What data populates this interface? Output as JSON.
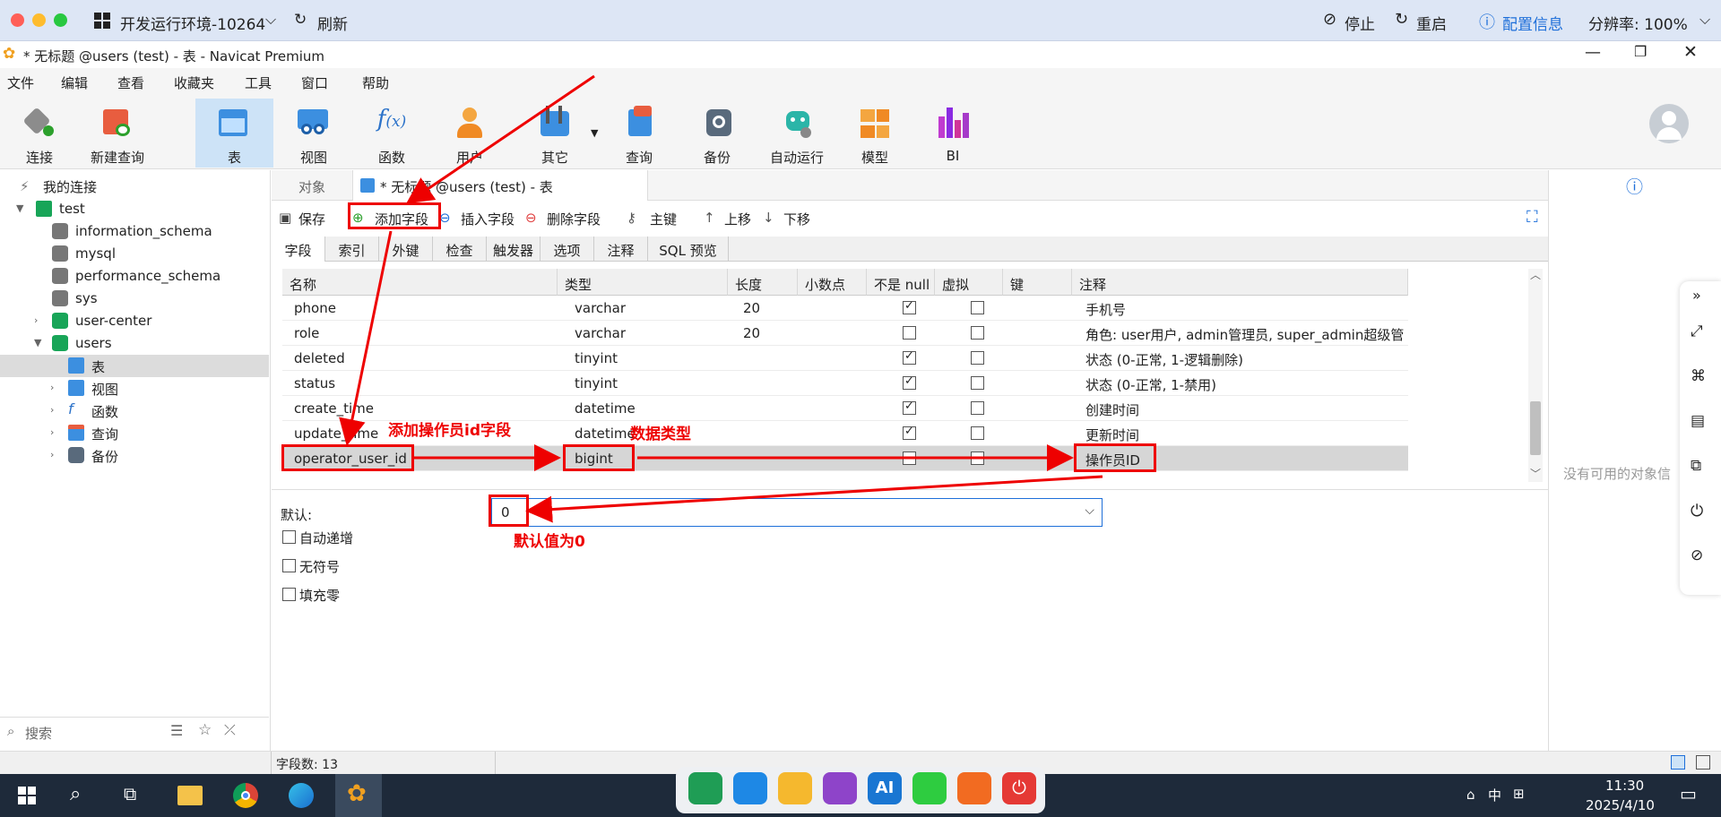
{
  "vm_bar": {
    "env_label": "开发运行环境-10264",
    "refresh": "刷新",
    "stop": "停止",
    "restart": "重启",
    "config": "配置信息",
    "resolution": "分辨率: 100%"
  },
  "window": {
    "title": "* 无标题 @users (test) - 表 - Navicat Premium"
  },
  "menu": [
    "文件",
    "编辑",
    "查看",
    "收藏夹",
    "工具",
    "窗口",
    "帮助"
  ],
  "toolbar": [
    "连接",
    "新建查询",
    "表",
    "视图",
    "函数",
    "用户",
    "其它",
    "查询",
    "备份",
    "自动运行",
    "模型",
    "BI"
  ],
  "sidebar": {
    "root": "我的连接",
    "connection": "test",
    "databases": [
      "information_schema",
      "mysql",
      "performance_schema",
      "sys",
      "user-center",
      "users"
    ],
    "users_children": [
      "表",
      "视图",
      "函数",
      "查询",
      "备份"
    ],
    "search_placeholder": "搜索"
  },
  "tabs": {
    "objects": "对象",
    "current": "* 无标题 @users (test) - 表"
  },
  "subtoolbar": {
    "save": "保存",
    "add_field": "添加字段",
    "insert_field": "插入字段",
    "delete_field": "删除字段",
    "primary_key": "主键",
    "move_up": "上移",
    "move_down": "下移"
  },
  "field_tabs": [
    "字段",
    "索引",
    "外键",
    "检查",
    "触发器",
    "选项",
    "注释",
    "SQL 预览"
  ],
  "columns": [
    "名称",
    "类型",
    "长度",
    "小数点",
    "不是 null",
    "虚拟",
    "键",
    "注释"
  ],
  "rows": [
    {
      "name": "phone",
      "type": "varchar",
      "length": "20",
      "notnull": true,
      "virtual": false,
      "comment": "手机号"
    },
    {
      "name": "role",
      "type": "varchar",
      "length": "20",
      "notnull": false,
      "virtual": false,
      "comment": "角色: user用户, admin管理员, super_admin超级管"
    },
    {
      "name": "deleted",
      "type": "tinyint",
      "length": "",
      "notnull": true,
      "virtual": false,
      "comment": "状态 (0-正常, 1-逻辑删除)"
    },
    {
      "name": "status",
      "type": "tinyint",
      "length": "",
      "notnull": true,
      "virtual": false,
      "comment": "状态 (0-正常, 1-禁用)"
    },
    {
      "name": "create_time",
      "type": "datetime",
      "length": "",
      "notnull": true,
      "virtual": false,
      "comment": "创建时间"
    },
    {
      "name": "update_time",
      "type": "datetime",
      "length": "",
      "notnull": true,
      "virtual": false,
      "comment": "更新时间"
    },
    {
      "name": "operator_user_id",
      "type": "bigint",
      "length": "",
      "notnull": false,
      "virtual": false,
      "comment": "操作员ID"
    }
  ],
  "props": {
    "default_label": "默认:",
    "default_value": "0",
    "auto_increment": "自动递增",
    "unsigned": "无符号",
    "zerofill": "填充零"
  },
  "annotations": {
    "add_field_note": "添加操作员id字段",
    "type_note": "数据类型",
    "default_note": "默认值为0"
  },
  "right_panel": {
    "empty": "没有可用的对象信"
  },
  "status": {
    "field_count": "字段数: 13"
  },
  "taskbar": {
    "time": "11:30",
    "date": "2025/4/10",
    "ime": "中"
  },
  "colors": {
    "accent": "#1e6fd9",
    "annotation": "#ee0000"
  }
}
